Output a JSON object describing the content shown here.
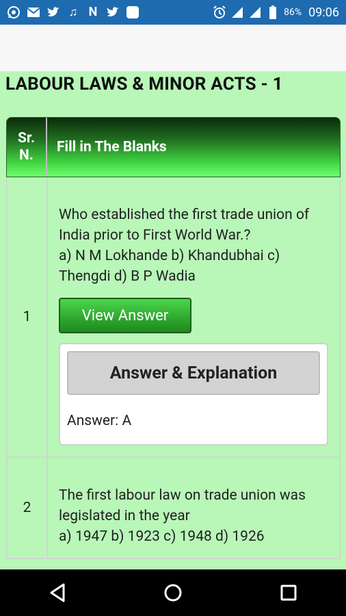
{
  "status_bar": {
    "icons": [
      "whatsapp-icon",
      "mail-icon",
      "twitter-icon",
      "music-icon",
      "n-app-icon",
      "twitter-icon",
      "square-app-icon"
    ],
    "right_icons": [
      "alarm-icon",
      "signal-icon",
      "signal-icon",
      "battery-icon"
    ],
    "battery": "86%",
    "time": "09:06"
  },
  "page": {
    "title": "LABOUR LAWS & MINOR ACTS - 1"
  },
  "table": {
    "header_sr": "Sr.\nN.",
    "header_q": "Fill in The Blanks",
    "rows": [
      {
        "sr": "1",
        "question": "Who established the first trade union of India prior to First World War.?\na) N M Lokhande b) Khandubhai c) Thengdi d) B P Wadia",
        "button": "View Answer",
        "answer_heading": "Answer & Explanation",
        "answer": "Answer: A"
      },
      {
        "sr": "2",
        "question": "The first labour law on trade union was legislated in the year\na) 1947 b) 1923 c) 1948 d) 1926"
      }
    ]
  },
  "colors": {
    "status_bar": "#1e6bb0",
    "page_bg": "#b8f7b8",
    "header_green": "#3fd23f",
    "button_green": "#2fa62f"
  }
}
